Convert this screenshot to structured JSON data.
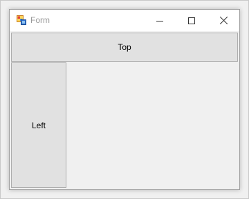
{
  "window": {
    "title": "Form",
    "icon": "windows-form-icon",
    "controls": {
      "minimize_icon": "minimize-icon",
      "maximize_icon": "maximize-icon",
      "close_icon": "close-icon"
    }
  },
  "panels": {
    "top_label": "Top",
    "left_label": "Left"
  },
  "colors": {
    "titlebar_bg": "#ffffff",
    "title_text": "#999999",
    "client_bg": "#f0f0f0",
    "button_face": "#e1e1e1",
    "button_border": "#adadad"
  }
}
